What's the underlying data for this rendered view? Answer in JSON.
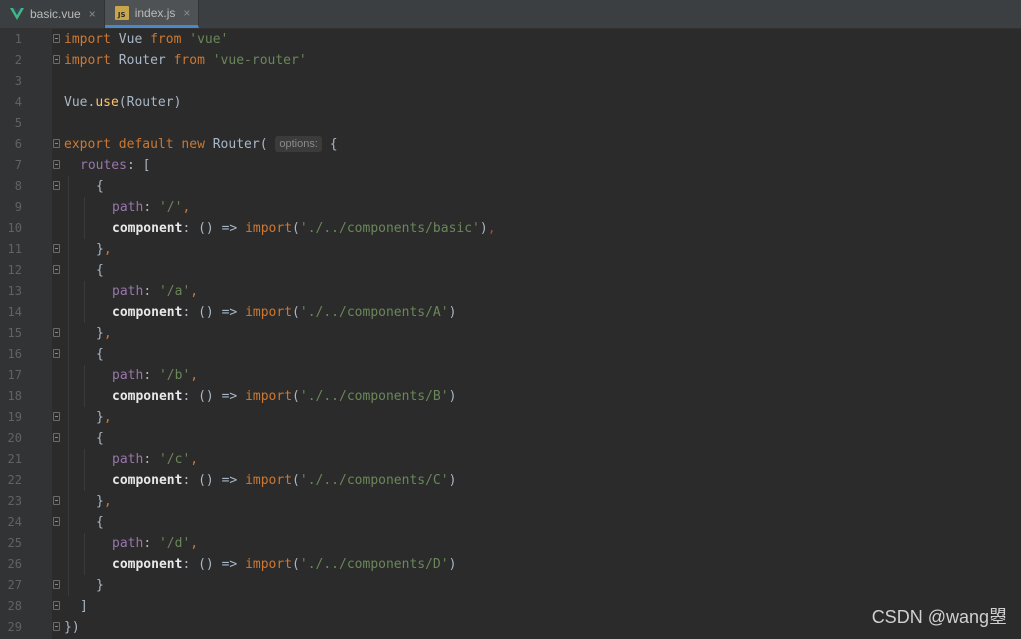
{
  "tabs": [
    {
      "label": "basic.vue",
      "icon": "vue-icon",
      "active": false
    },
    {
      "label": "index.js",
      "icon": "js-icon",
      "active": true
    }
  ],
  "js_badge": "JS",
  "close_glyph": "×",
  "lines": [
    {
      "n": "1",
      "t": "import Vue from 'vue'"
    },
    {
      "n": "2",
      "t": "import Router from 'vue-router'"
    },
    {
      "n": "3",
      "t": ""
    },
    {
      "n": "4",
      "t": "Vue.use(Router)"
    },
    {
      "n": "5",
      "t": ""
    },
    {
      "n": "6",
      "t": "export default new Router( options: {"
    },
    {
      "n": "7",
      "t": "routes: ["
    },
    {
      "n": "8",
      "t": "{"
    },
    {
      "n": "9",
      "t": "path: '/',"
    },
    {
      "n": "10",
      "t": "component: () => import('./../components/basic'),"
    },
    {
      "n": "11",
      "t": "},"
    },
    {
      "n": "12",
      "t": "{"
    },
    {
      "n": "13",
      "t": "path: '/a',"
    },
    {
      "n": "14",
      "t": "component: () => import('./../components/A')"
    },
    {
      "n": "15",
      "t": "},"
    },
    {
      "n": "16",
      "t": "{"
    },
    {
      "n": "17",
      "t": "path: '/b',"
    },
    {
      "n": "18",
      "t": "component: () => import('./../components/B')"
    },
    {
      "n": "19",
      "t": "},"
    },
    {
      "n": "20",
      "t": "{"
    },
    {
      "n": "21",
      "t": "path: '/c',"
    },
    {
      "n": "22",
      "t": "component: () => import('./../components/C')"
    },
    {
      "n": "23",
      "t": "},"
    },
    {
      "n": "24",
      "t": "{"
    },
    {
      "n": "25",
      "t": "path: '/d',"
    },
    {
      "n": "26",
      "t": "component: () => import('./../components/D')"
    },
    {
      "n": "27",
      "t": "}"
    },
    {
      "n": "28",
      "t": "]"
    },
    {
      "n": "29",
      "t": "})"
    }
  ],
  "watermark": "CSDN @wang曌",
  "colors": {
    "background": "#2b2b2b",
    "gutter": "#313335",
    "keyword": "#cc7832",
    "string": "#6a8759",
    "property": "#9876aa",
    "function": "#ffc66d",
    "text": "#a9b7c6",
    "tab_accent": "#4a88c7"
  }
}
